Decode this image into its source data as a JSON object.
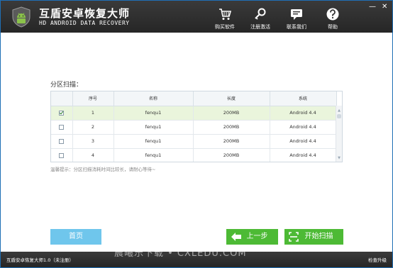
{
  "header": {
    "title": "互盾安卓恢复大师",
    "subtitle": "HD ANDROID DATA RECOVERY",
    "nav": [
      {
        "label": "购买软件",
        "icon": "cart-icon"
      },
      {
        "label": "注册激活",
        "icon": "key-icon"
      },
      {
        "label": "联系我们",
        "icon": "chat-icon"
      },
      {
        "label": "帮助",
        "icon": "help-icon"
      }
    ],
    "window_controls": {
      "minimize": "—",
      "close": "✕"
    }
  },
  "section": {
    "label": "分区扫描："
  },
  "table": {
    "columns": [
      "",
      "序号",
      "名称",
      "长度",
      "系统"
    ],
    "rows": [
      {
        "checked": true,
        "index": "1",
        "name": "fenqu1",
        "length": "200MB",
        "system": "Android 4.4"
      },
      {
        "checked": false,
        "index": "2",
        "name": "fenqu1",
        "length": "200MB",
        "system": "Android 4.4"
      },
      {
        "checked": false,
        "index": "3",
        "name": "fenqu1",
        "length": "200MB",
        "system": "Android 4.4"
      },
      {
        "checked": false,
        "index": "4",
        "name": "fenqu1",
        "length": "200MB",
        "system": "Android 4.4"
      }
    ]
  },
  "hint": "温馨提示：分区扫描消耗时间比较长，请耐心等待~",
  "buttons": {
    "home": "首页",
    "prev": "上一步",
    "start": "开始扫描"
  },
  "status": {
    "left": "互盾安卓恢复大师1.0（未注册）",
    "right": "检查升级"
  },
  "watermark": "晨曦乐下载 • CXLEDU.COM",
  "colors": {
    "accent_green": "#4dba35",
    "accent_blue": "#6fc6ec",
    "header_bg": "#2f2f2f"
  }
}
